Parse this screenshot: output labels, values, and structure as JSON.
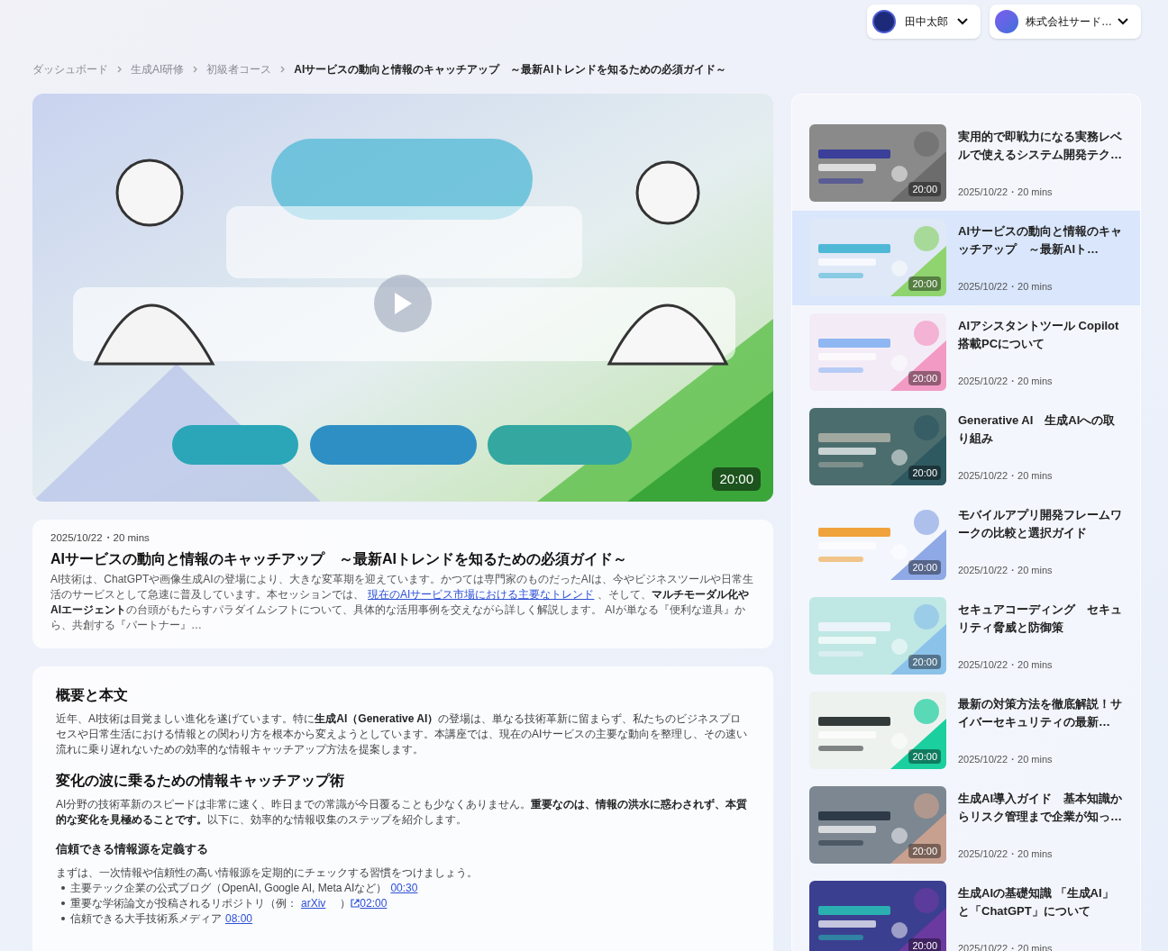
{
  "header": {
    "accounts": [
      {
        "name": "田中太郎",
        "kind": "user"
      },
      {
        "name": "株式会社サード…",
        "kind": "org"
      }
    ]
  },
  "breadcrumb": [
    {
      "label": "ダッシュボード",
      "current": false
    },
    {
      "label": "生成AI研修",
      "current": false
    },
    {
      "label": "初級者コース",
      "current": false
    },
    {
      "label": "AIサービスの動向と情報のキャッチアップ　～最新AIトレンドを知るための必須ガイド～",
      "current": true
    }
  ],
  "video": {
    "duration": "20:00"
  },
  "description": {
    "meta": "2025/10/22・20 mins",
    "title": "AIサービスの動向と情報のキャッチアップ　～最新AIトレンドを知るための必須ガイド～",
    "segments": [
      {
        "kind": "plain",
        "text": "AI技術は、ChatGPTや画像生成AIの登場により、大きな変革期を迎えています。かつては専門家のものだったAIは、今やビジネスツールや日常生活のサービスとして急速に普及しています。本セッションでは、"
      },
      {
        "kind": "link",
        "text": "現在のAIサービス市場における主要なトレンド"
      },
      {
        "kind": "plain",
        "text": "、そして、"
      },
      {
        "kind": "bold",
        "text": "マルチモーダル化やAIエージェント"
      },
      {
        "kind": "plain",
        "text": "の台頭がもたらすパラダイムシフトについて、具体的な活用事例を交えながら詳しく解説します。 AIが単なる『便利な道具』から、共創する『パートナー』…"
      }
    ]
  },
  "body": [
    {
      "kind": "h2",
      "text": "概要と本文"
    },
    {
      "kind": "p",
      "segments": [
        {
          "kind": "plain",
          "text": "近年、AI技術は目覚ましい進化を遂げています。特に"
        },
        {
          "kind": "bold",
          "text": "生成AI（Generative AI）"
        },
        {
          "kind": "plain",
          "text": "の登場は、単なる技術革新に留まらず、私たちのビジネスプロセスや日常生活における情報との関わり方を根本から変えようとしています。本講座では、現在のAIサービスの主要な動向を整理し、その速い流れに乗り遅れないための効率的な情報キャッチアップ方法を提案します。"
        }
      ]
    },
    {
      "kind": "h2",
      "text": "変化の波に乗るための情報キャッチアップ術"
    },
    {
      "kind": "p",
      "segments": [
        {
          "kind": "plain",
          "text": "AI分野の技術革新のスピードは非常に速く、昨日までの常識が今日覆ることも少なくありません。"
        },
        {
          "kind": "bold",
          "text": "重要なのは、情報の洪水に惑わされず、本質的な変化を見極めることです。"
        },
        {
          "kind": "plain",
          "text": "以下に、効率的な情報収集のステップを紹介します。"
        }
      ]
    },
    {
      "kind": "h3",
      "text": "信頼できる情報源を定義する"
    },
    {
      "kind": "p",
      "segments": [
        {
          "kind": "plain",
          "text": "まずは、一次情報や信頼性の高い情報源を定期的にチェックする習慣をつけましょう。"
        }
      ]
    },
    {
      "kind": "list",
      "items": [
        [
          {
            "kind": "plain",
            "text": "主要テック企業の公式ブログ（OpenAI, Google AI, Meta AIなど）"
          },
          {
            "kind": "link",
            "text": "00:30"
          }
        ],
        [
          {
            "kind": "plain",
            "text": "重要な学術論文が投稿されるリポジトリ（例："
          },
          {
            "kind": "link",
            "text": "arXiv"
          },
          {
            "kind": "plain",
            "text": "　）"
          },
          {
            "kind": "extlink",
            "text": "02:00"
          }
        ],
        [
          {
            "kind": "plain",
            "text": "信頼できる大手技術系メディア"
          },
          {
            "kind": "link",
            "text": "08:00"
          }
        ]
      ]
    }
  ],
  "playlist": [
    {
      "title": "実用的で即戦力になる実務レベルで使えるシステム開発テク…",
      "meta": "2025/10/22・20 mins",
      "duration": "20:00",
      "selected": false
    },
    {
      "title": "AIサービスの動向と情報のキャッチアップ　～最新AIト…",
      "meta": "2025/10/22・20 mins",
      "duration": "20:00",
      "selected": true
    },
    {
      "title": "AIアシスタントツール Copilot搭載PCについて",
      "meta": "2025/10/22・20 mins",
      "duration": "20:00",
      "selected": false
    },
    {
      "title": "Generative AI　生成AIへの取り組み",
      "meta": "2025/10/22・20 mins",
      "duration": "20:00",
      "selected": false
    },
    {
      "title": "モバイルアプリ開発フレームワークの比較と選択ガイド",
      "meta": "2025/10/22・20 mins",
      "duration": "20:00",
      "selected": false
    },
    {
      "title": "セキュアコーディング　セキュリティ脅威と防御策",
      "meta": "2025/10/22・20 mins",
      "duration": "20:00",
      "selected": false
    },
    {
      "title": "最新の対策方法を徹底解説！サイバーセキュリティの最新…",
      "meta": "2025/10/22・20 mins",
      "duration": "20:00",
      "selected": false
    },
    {
      "title": "生成AI導入ガイド　基本知識からリスク管理まで企業が知っ…",
      "meta": "2025/10/22・20 mins",
      "duration": "20:00",
      "selected": false
    },
    {
      "title": "生成AIの基礎知識 「生成AI」と「ChatGPT」について",
      "meta": "2025/10/22・20 mins",
      "duration": "20:00",
      "selected": false
    }
  ]
}
